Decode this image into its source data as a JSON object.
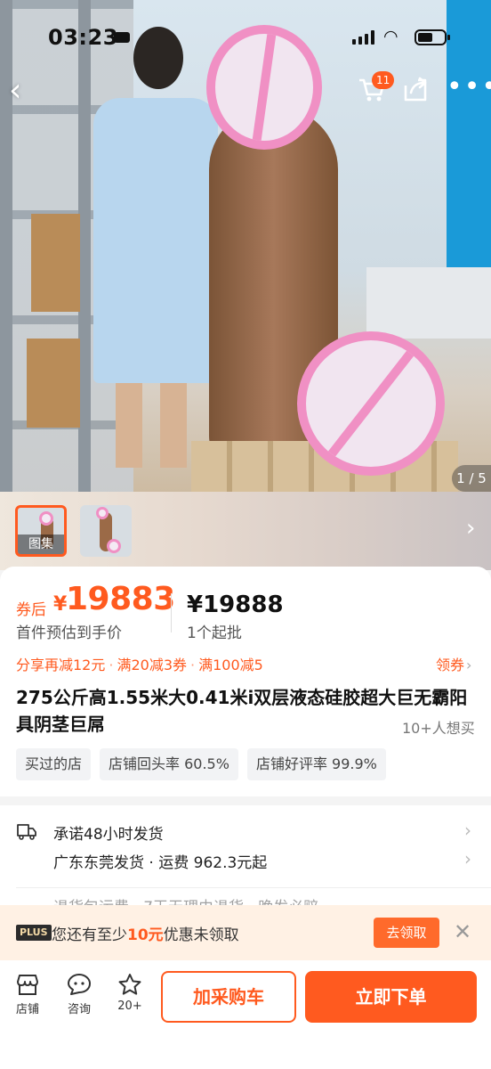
{
  "status_bar": {
    "time": "03:23"
  },
  "gallery": {
    "counter": "1 / 5",
    "thumb_label": "图集"
  },
  "nav": {
    "cart_badge": "11"
  },
  "price": {
    "after_coupon_label": "券后",
    "currency": "¥",
    "after_coupon_value": "19883",
    "estimate_note": "首件预估到手价",
    "original": "¥19888",
    "min_order": "1个起批"
  },
  "promotions": [
    "分享再减12元",
    "满20减3券",
    "满100减5"
  ],
  "coupon_link": "领券",
  "product": {
    "title": "275公斤高1.55米大0.41米i双层液态硅胶超大巨无霸阳具阴茎巨屌",
    "want_count": "10+人想买"
  },
  "tags": [
    "买过的店",
    "店铺回头率 60.5%",
    "店铺好评率 99.9%"
  ],
  "shipping": {
    "promise": "承诺48小时发货",
    "origin": "广东东莞发货",
    "fee": "运费 962.3元起",
    "faded_line": "退货包运费 · 7天无理由退货 · 晚发必赔"
  },
  "plus_banner": {
    "badge": "PLUS",
    "text_before": "您还有至少",
    "amount": "10元",
    "text_after": "优惠未领取",
    "button": "去领取"
  },
  "bottom_bar": {
    "shop_label": "店铺",
    "chat_label": "咨询",
    "fav_label": "20+",
    "add_cart": "加采购车",
    "buy_now": "立即下单"
  },
  "colors": {
    "accent": "#ff5a1f",
    "censor": "#f090c4"
  }
}
